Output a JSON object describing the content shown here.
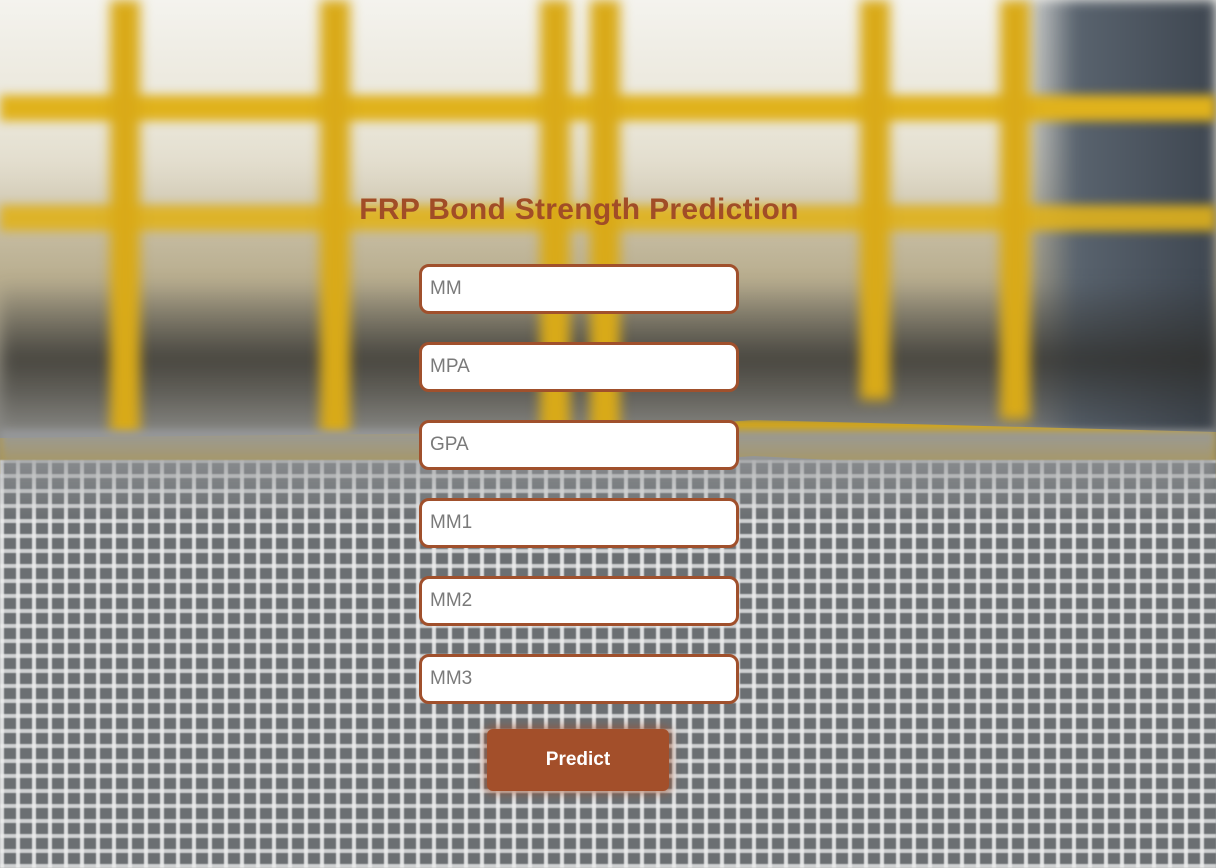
{
  "page": {
    "title": "FRP Bond Strength Prediction",
    "accent_color": "#a34f2a",
    "background": "blurred industrial walkway with yellow railings and steel grating"
  },
  "form": {
    "fields": [
      {
        "name": "mm",
        "placeholder": "MM",
        "value": ""
      },
      {
        "name": "mpa",
        "placeholder": "MPA",
        "value": ""
      },
      {
        "name": "gpa",
        "placeholder": "GPA",
        "value": ""
      },
      {
        "name": "mm1",
        "placeholder": "MM1",
        "value": ""
      },
      {
        "name": "mm2",
        "placeholder": "MM2",
        "value": ""
      },
      {
        "name": "mm3",
        "placeholder": "MM3",
        "value": ""
      }
    ],
    "submit_label": "Predict"
  }
}
